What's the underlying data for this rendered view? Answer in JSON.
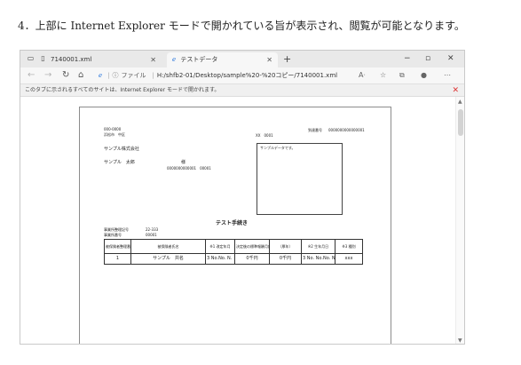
{
  "caption": "4．上部に Internet Explorer モードで開かれている旨が表示され、閲覧が可能となります。",
  "tabs": [
    {
      "title": "7140001.xml",
      "active": false
    },
    {
      "title": "テストデータ",
      "active": true
    }
  ],
  "address": {
    "info_icon": "ⓘ",
    "label": "ファイル",
    "url": "H:/shfb2-01/Desktop/sample%20-%20コピー/7140001.xml"
  },
  "ie_banner": "このタブに示されるすべてのサイトは、Internet Explorer モードで開かれます。",
  "document": {
    "postal": "000-0000",
    "address_line": "浜松市　中区",
    "company": "サンプル株式会社",
    "person": "サンプル　太郎",
    "honorific": "様",
    "small_code": "0000000000001　00001",
    "number_label": "XX　0001",
    "reg_label": "到達番号",
    "reg_value": "0000000000000001",
    "note_text": "サンプルデータです。",
    "title": "テスト手続き",
    "office_label": "事業所整理記号",
    "office_value": "22-333",
    "office_no_label": "事業所番号",
    "office_no_value": "00001",
    "headers": [
      "被保険者整理番号",
      "被保険者氏名",
      "※1 改定年月",
      "決定後の標準報酬月額（健保）",
      "（厚年）",
      "※2 生年月日",
      "※3 種別"
    ],
    "row": {
      "number": "1",
      "name": "サンプル　共名",
      "date": "3  No.No. N.　N.",
      "health": "0千円",
      "pension": "0千円",
      "birth": "3  No.  No.No. N.　N.　N.",
      "type": "xxx"
    }
  }
}
